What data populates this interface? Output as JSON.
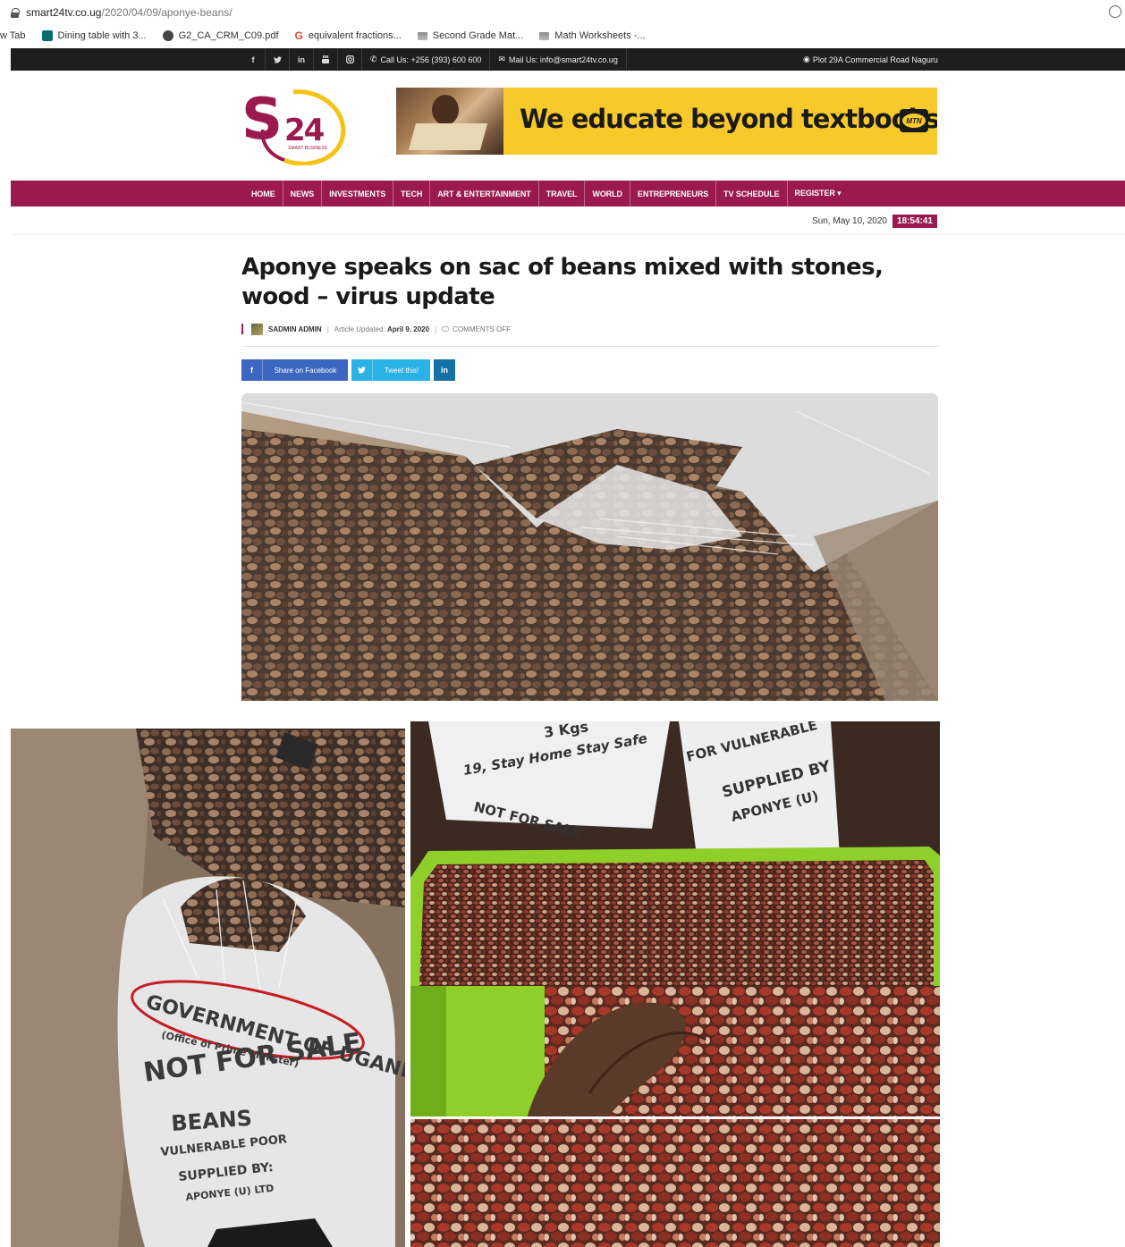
{
  "browser": {
    "url_domain": "smart24tv.co.ug",
    "url_path": "/2020/04/09/aponye-beans/"
  },
  "bookmarks": [
    {
      "label": "w Tab",
      "icon": "none"
    },
    {
      "label": "Dining table with 3...",
      "icon": "teal-square-icon"
    },
    {
      "label": "G2_CA_CRM_C09.pdf",
      "icon": "chrome-icon"
    },
    {
      "label": "equivalent fractions...",
      "icon": "google-icon"
    },
    {
      "label": "Second Grade Mat...",
      "icon": "book-icon"
    },
    {
      "label": "Math Worksheets -...",
      "icon": "book-icon"
    }
  ],
  "topbar": {
    "social": [
      "f",
      "t",
      "in",
      "yt",
      "ig"
    ],
    "phone": "Call Us: +256 (393) 600 600",
    "mail": "Mail Us: info@smart24tv.co.ug",
    "location": "Plot 29A Commercial Road Naguru"
  },
  "logo": {
    "text": "S24",
    "tagline": "SMART BUSINESS"
  },
  "banner": {
    "slogan": "We educate beyond textbooks.",
    "brand": "MTN"
  },
  "nav": [
    "HOME",
    "NEWS",
    "INVESTMENTS",
    "TECH",
    "ART & ENTERTAINMENT",
    "TRAVEL",
    "WORLD",
    "ENTREPRENEURS",
    "TV SCHEDULE",
    "REGISTER ▾"
  ],
  "date": {
    "day": "Sun, May 10, 2020",
    "time": "18:54:41"
  },
  "article": {
    "title": "Aponye speaks on sac of beans mixed with stones, wood – virus update",
    "author": "SADMIN ADMIN",
    "updated_label": "Article Updated:",
    "updated_date": "April 9, 2020",
    "comments": "COMMENTS OFF"
  },
  "share": {
    "facebook": "Share on Facebook",
    "twitter": "Tweet this!",
    "linkedin": "in"
  },
  "photo_texts": {
    "sack1": [
      "GOVERNMENT OF UGANDA",
      "(Office of Prime Minister)",
      "NOT FOR SALE",
      "BEANS",
      "VULNERABLE POOR",
      "SUPPLIED BY:",
      "APONYE (U) LTD"
    ],
    "sack2": [
      "3 Kgs",
      "19, Stay Home Stay Safe",
      "NOT FOR SALE"
    ],
    "sack3": [
      "FOR VULNERABLE",
      "SUPPLIED BY",
      "APONYE (U)"
    ]
  },
  "colors": {
    "brand": "#9a1a4f",
    "banner": "#f7c92a",
    "topbar": "#1e1e1e"
  }
}
